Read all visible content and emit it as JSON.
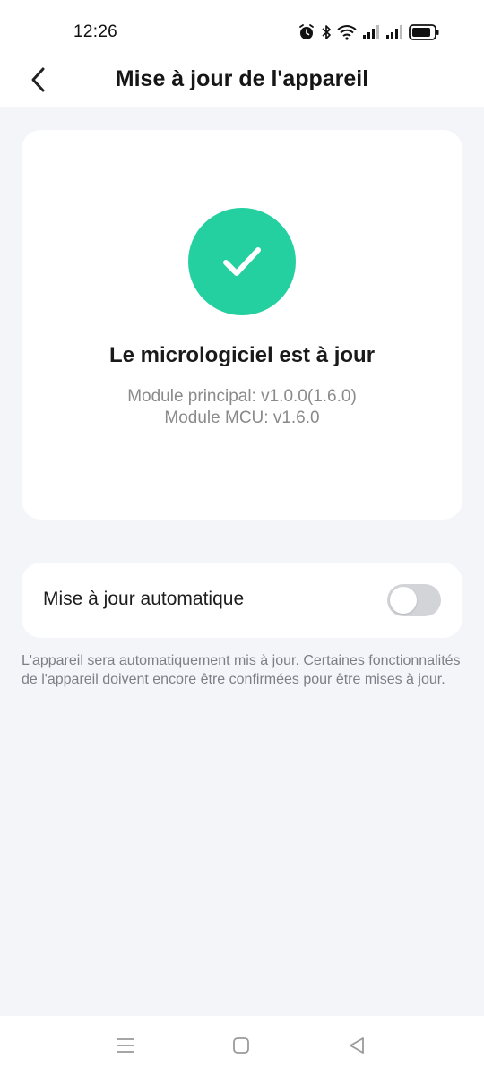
{
  "status_bar": {
    "time": "12:26",
    "icons": [
      "alarm-icon",
      "bluetooth-icon",
      "wifi-icon",
      "signal-icon",
      "signal-icon",
      "battery-icon"
    ]
  },
  "header": {
    "title": "Mise à jour de l'appareil",
    "back_icon": "chevron-left-icon"
  },
  "firmware": {
    "status_icon": "check-icon",
    "status": "Le micrologiciel est à jour",
    "main_module": "Module principal: v1.0.0(1.6.0)",
    "mcu_module": "Module MCU: v1.6.0"
  },
  "auto_update": {
    "label": "Mise à jour automatique",
    "enabled": false
  },
  "hint": "L'appareil sera automatiquement mis à jour. Certaines fonctionnalités de l'appareil doivent encore être confirmées pour être mises à jour.",
  "nav_bar": {
    "icons": [
      "menu-icon",
      "home-icon",
      "back-triangle-icon"
    ]
  },
  "colors": {
    "accent": "#25d0a0",
    "background": "#f4f5f9",
    "card": "#ffffff",
    "toggle_off": "#d3d4d8"
  }
}
